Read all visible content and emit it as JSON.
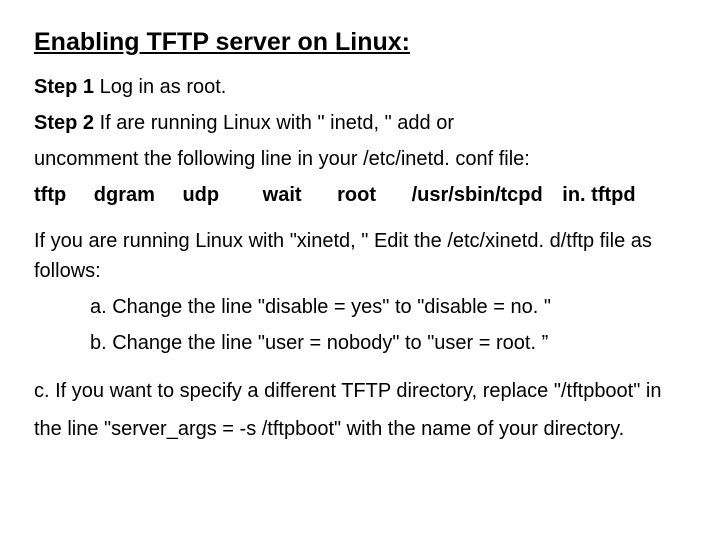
{
  "doc": {
    "title": "Enabling TFTP server on Linux:",
    "step1_label": "Step 1",
    "step1_text": " Log in as root.",
    "step2_label": "Step 2",
    "step2_text": " If are running Linux with \"   inetd, \" add or",
    "uncomment_text": "uncomment the following line in your /etc/inetd. conf file:",
    "cfg_tftp": "tftp",
    "cfg_dgram": "dgram",
    "cfg_udp": "udp",
    "cfg_wait": "wait",
    "cfg_root": "root",
    "cfg_path": "/usr/sbin/tcpd",
    "cfg_daemon": "in. tftpd",
    "xinetd_intro": "If you are running Linux with \"xinetd, \" Edit the /etc/xinetd. d/tftp file as follows:",
    "item_a": "a. Change the line \"disable = yes\" to \"disable = no. \"",
    "item_b": "b. Change the line \"user = nobody\" to \"user = root. ”",
    "item_c": "c. If you want to specify a different TFTP directory, replace \"/tftpboot\" in the line \"server_args = -s /tftpboot\" with the name of your directory."
  }
}
